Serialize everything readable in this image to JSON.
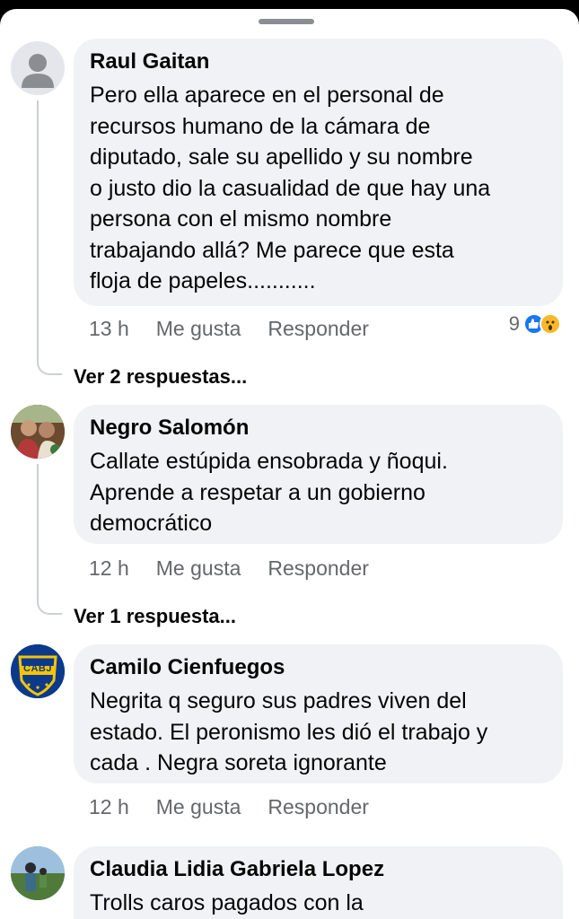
{
  "comments": [
    {
      "author": "Raul Gaitan",
      "lines": [
        "Pero ella aparece en el personal de",
        "recursos humano de la cámara de",
        "diputado,  sale su apellido y su nombre",
        "o justo dio la casualidad de que hay una",
        "persona con el mismo nombre",
        "trabajando allá? Me parece que esta",
        "floja de papeles..........."
      ],
      "time": "13 h",
      "like": "Me gusta",
      "reply": "Responder",
      "reaction_count": "9",
      "reaction_icons": [
        "like-icon",
        "wow-icon"
      ],
      "view_replies": "Ver 2 respuestas..."
    },
    {
      "author": "Negro Salomón",
      "lines": [
        "Callate estúpida ensobrada y ñoqui.",
        "Aprende a respetar a un gobierno",
        "democrático"
      ],
      "time": "12 h",
      "like": "Me gusta",
      "reply": "Responder",
      "view_replies": "Ver 1 respuesta..."
    },
    {
      "author": "Camilo Cienfuegos",
      "lines": [
        "Negrita q seguro sus padres viven del",
        "estado. El peronismo les dió el trabajo y",
        "cada . Negra soreta  ignorante"
      ],
      "time": "12 h",
      "like": "Me gusta",
      "reply": "Responder",
      "avatar_text": "CABJ"
    },
    {
      "author": "Claudia Lidia Gabriela Lopez",
      "lines": [
        "Trolls caros pagados con la"
      ]
    }
  ],
  "colors": {
    "bubble": "#f0f2f5",
    "meta": "#65676b",
    "like_blue": "#1877f2",
    "wow_yellow": "#f7b928",
    "boca_blue": "#0b3a8c",
    "boca_gold": "#f6c400"
  }
}
